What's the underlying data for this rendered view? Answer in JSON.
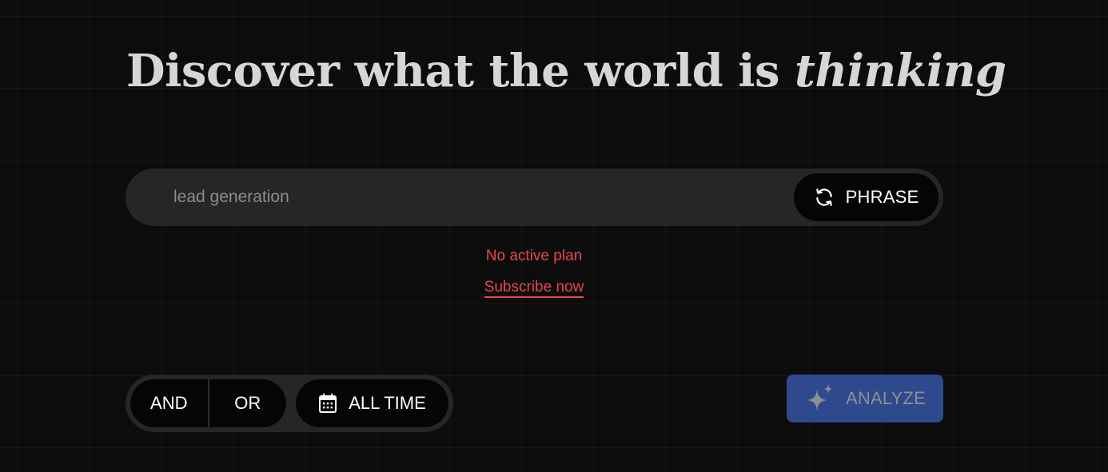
{
  "hero": {
    "title_prefix": "Discover what the world is ",
    "title_emphasis": "thinking"
  },
  "search": {
    "placeholder": "lead generation",
    "value": "",
    "mode_button_label": "PHRASE",
    "mode_button_icon": "refresh-icon"
  },
  "notice": {
    "message": "No active plan",
    "link_label": "Subscribe now",
    "color": "#e8474c"
  },
  "filters": {
    "logic_options": [
      "AND",
      "OR"
    ],
    "time_range_label": "ALL TIME",
    "time_range_icon": "calendar-icon"
  },
  "analyze": {
    "label": "ANALYZE",
    "icon": "sparkle-icon",
    "color": "#2e4a8c"
  }
}
